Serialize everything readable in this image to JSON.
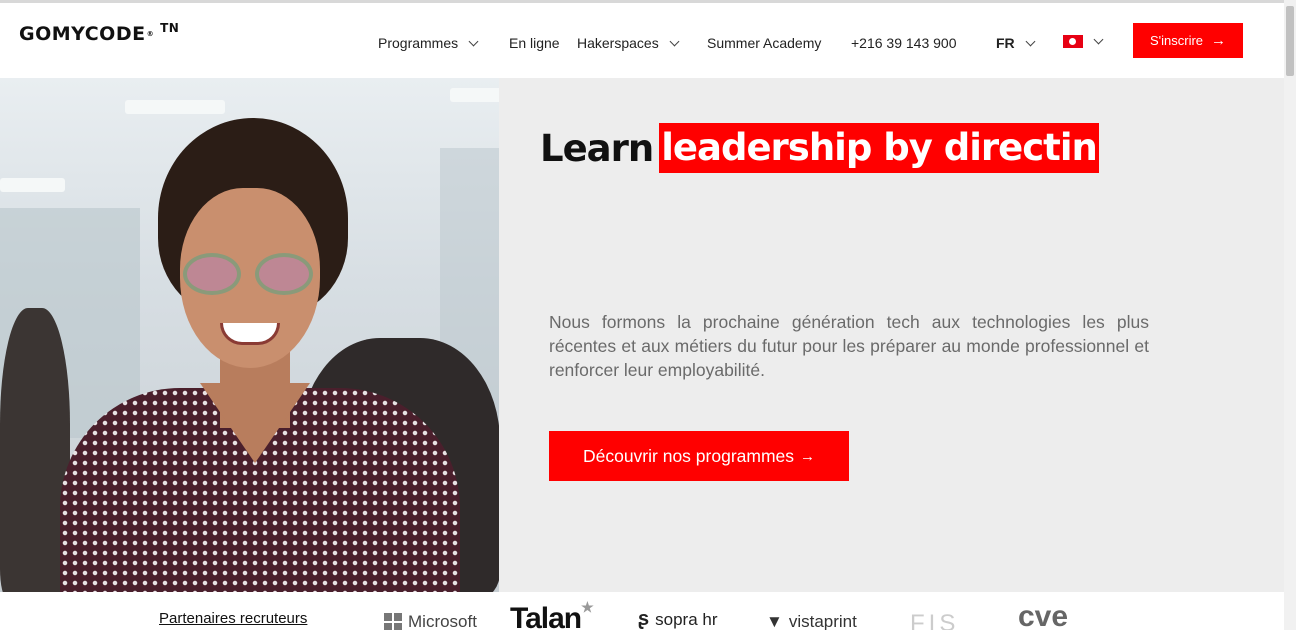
{
  "header": {
    "logo_text": "GOMYCODE",
    "logo_country": "TN",
    "nav": [
      {
        "label": "Programmes",
        "has_dropdown": true
      },
      {
        "label": "En ligne",
        "has_dropdown": false
      },
      {
        "label": "Hakerspaces",
        "has_dropdown": true
      },
      {
        "label": "Summer Academy",
        "has_dropdown": false
      },
      {
        "label": "+216 39 143 900",
        "has_dropdown": false
      }
    ],
    "language": "FR",
    "country_flag_icon": "tunisia-flag-icon",
    "signup_label": "S'inscrire",
    "accent_color": "#ff0000"
  },
  "hero": {
    "title_prefix": "Learn",
    "title_highlight": "leadership by directin",
    "description": "Nous formons la prochaine génération tech aux technologies les plus récentes et aux métiers du futur pour les préparer au monde professionnel et renforcer leur employabilité.",
    "cta_label": "Découvrir nos programmes",
    "background_color": "#ededed"
  },
  "partners": {
    "label": "Partenaires recruteurs",
    "logos": [
      "Microsoft",
      "Talan",
      "sopra hr",
      "vistaprint",
      "FIS",
      "cve"
    ]
  }
}
